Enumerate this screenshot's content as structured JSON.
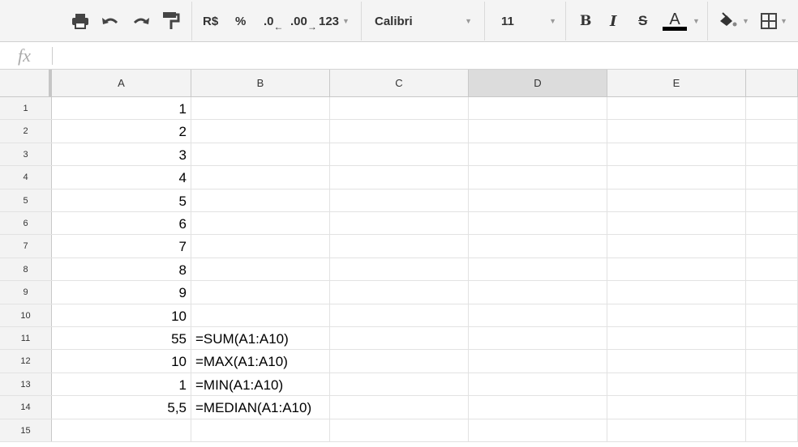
{
  "toolbar": {
    "currency": "R$",
    "percent": "%",
    "dec_decrease": ".0",
    "dec_increase": ".00",
    "more_formats": "123",
    "font": "Calibri",
    "font_size": "11",
    "bold": "B",
    "italic": "I",
    "strike": "S",
    "text_color": "A",
    "text_color_hex": "#000000"
  },
  "formula_bar": {
    "fx": "fx",
    "value": ""
  },
  "columns": [
    "A",
    "B",
    "C",
    "D",
    "E",
    ""
  ],
  "rows": [
    {
      "n": "1",
      "a": "1",
      "b": ""
    },
    {
      "n": "2",
      "a": "2",
      "b": ""
    },
    {
      "n": "3",
      "a": "3",
      "b": ""
    },
    {
      "n": "4",
      "a": "4",
      "b": ""
    },
    {
      "n": "5",
      "a": "5",
      "b": ""
    },
    {
      "n": "6",
      "a": "6",
      "b": ""
    },
    {
      "n": "7",
      "a": "7",
      "b": ""
    },
    {
      "n": "8",
      "a": "8",
      "b": ""
    },
    {
      "n": "9",
      "a": "9",
      "b": ""
    },
    {
      "n": "10",
      "a": "10",
      "b": ""
    },
    {
      "n": "11",
      "a": "55",
      "b": "=SUM(A1:A10)"
    },
    {
      "n": "12",
      "a": "10",
      "b": "=MAX(A1:A10)"
    },
    {
      "n": "13",
      "a": "1",
      "b": "=MIN(A1:A10)"
    },
    {
      "n": "14",
      "a": "5,5",
      "b": "=MEDIAN(A1:A10)"
    },
    {
      "n": "15",
      "a": "",
      "b": ""
    }
  ]
}
